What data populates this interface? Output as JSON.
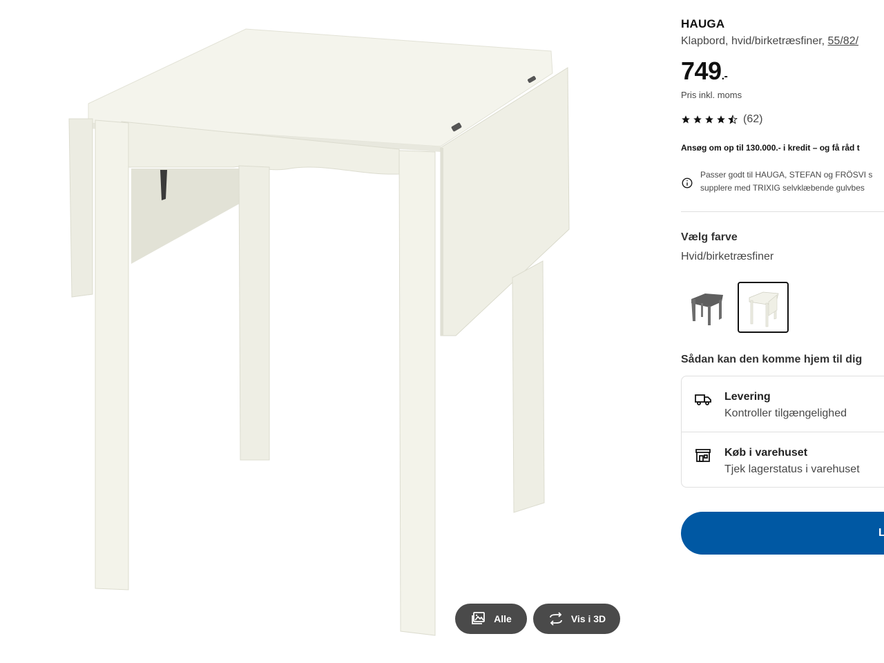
{
  "product": {
    "name": "HAUGA",
    "description": "Klapbord, hvid/birketræsfiner, ",
    "measure": "55/82/",
    "price_main": "749",
    "price_suffix": ".-",
    "vat_note": "Pris inkl. moms"
  },
  "rating": {
    "stars": 4.5,
    "max_stars": 5,
    "review_count": "(62)"
  },
  "credit": {
    "text": "Ansøg om op til 130.000.- i kredit – og få råd t"
  },
  "compatibility": {
    "line1": "Passer godt til HAUGA, STEFAN og FRÖSVI s",
    "line2": "supplere med TRIXIG selvklæbende gulvbes",
    "icon": "info-icon"
  },
  "color": {
    "heading": "Vælg farve",
    "selected": "Hvid/birketræsfiner",
    "swatches": [
      "grey-table-thumbnail",
      "white-table-thumbnail"
    ]
  },
  "delivery": {
    "heading": "Sådan kan den komme hjem til dig",
    "options": [
      {
        "title": "Levering",
        "subtitle": "Kontroller tilgængelighed",
        "icon": "truck-icon"
      },
      {
        "title": "Køb i varehuset",
        "subtitle": "Tjek lagerstatus i varehuset",
        "icon": "store-icon"
      }
    ]
  },
  "cta": {
    "label": "L"
  },
  "gallery": {
    "all_label": "Alle",
    "view3d_label": "Vis i 3D",
    "all_icon": "gallery-icon",
    "view3d_icon": "rotate-3d-icon"
  },
  "colors": {
    "cta_blue": "#0058a3",
    "gallery_button": "#4a4a4a",
    "text_muted": "#484848",
    "border": "#dfdfdf"
  }
}
